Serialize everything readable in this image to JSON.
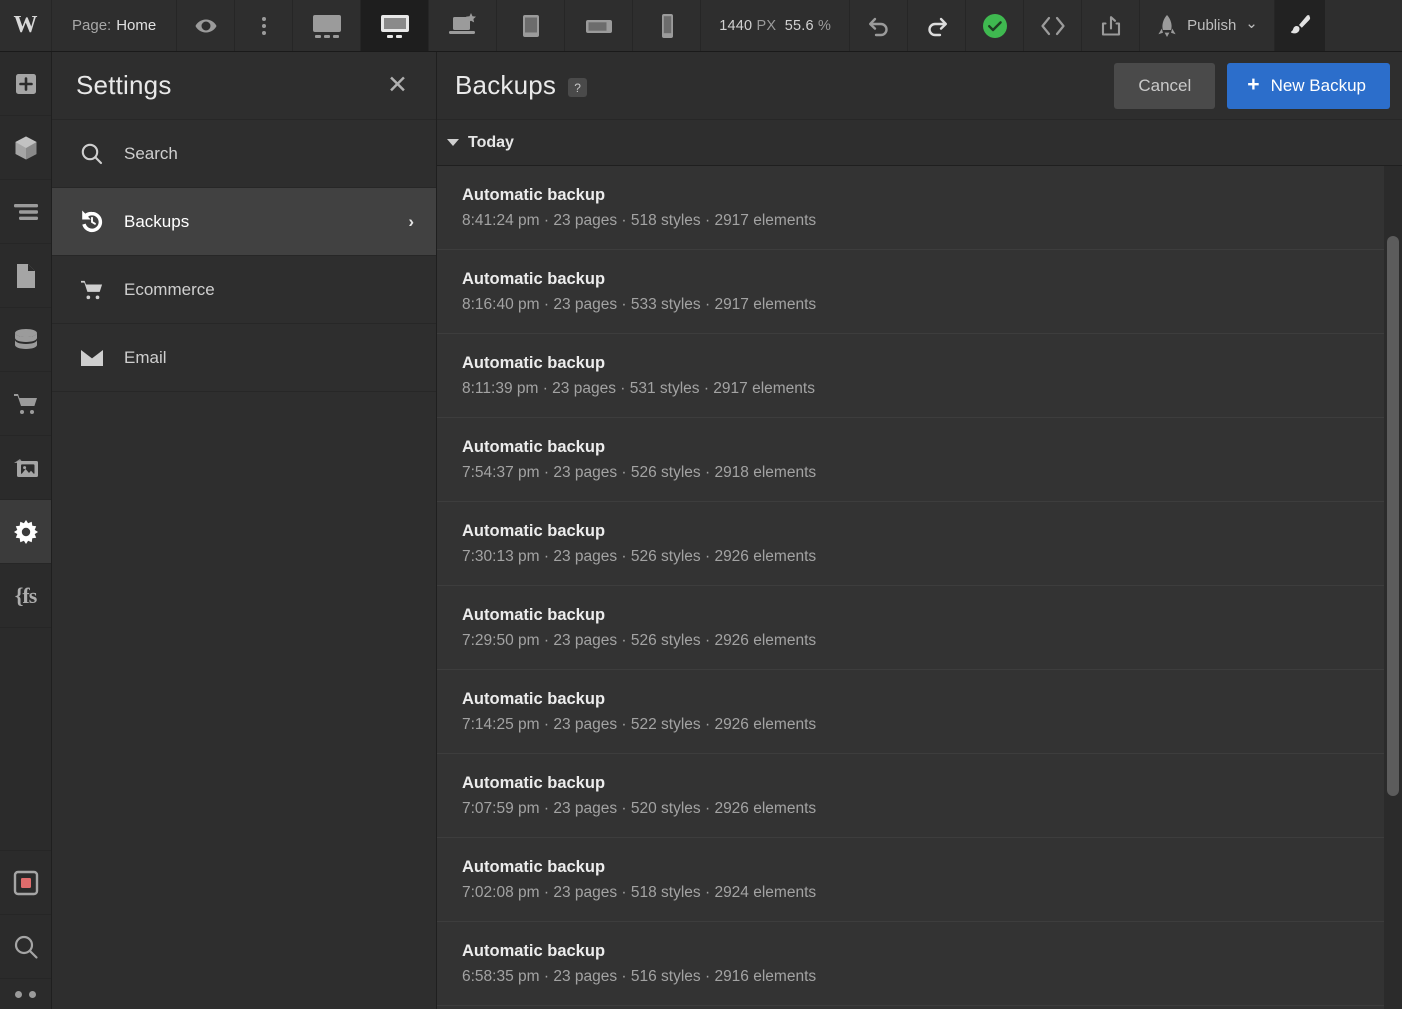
{
  "topbar": {
    "logo": "W",
    "page_label": "Page:",
    "page_name": "Home",
    "preview_icon": "eye-icon",
    "more_icon": "kebab-menu-icon",
    "devices": [
      {
        "name": "device-desktop-large",
        "label": "Desktop large"
      },
      {
        "name": "device-desktop",
        "label": "Desktop",
        "active": true
      },
      {
        "name": "device-desktop-starred",
        "label": "Desktop starred"
      },
      {
        "name": "device-tablet",
        "label": "Tablet"
      },
      {
        "name": "device-mobile-landscape",
        "label": "Mobile landscape"
      },
      {
        "name": "device-mobile-portrait",
        "label": "Mobile portrait"
      }
    ],
    "canvas_width": "1440",
    "canvas_width_unit": "PX",
    "zoom_value": "55.6",
    "zoom_unit": "%",
    "undo_icon": "undo-icon",
    "redo_icon": "redo-icon",
    "saved_icon": "checkmark-saved-icon",
    "code_icon": "code-brackets-icon",
    "export_icon": "export-share-icon",
    "publish_icon": "rocket-icon",
    "publish_label": "Publish",
    "publish_caret": "⌄",
    "brush_icon": "paintbrush-icon"
  },
  "rail": {
    "items": [
      {
        "name": "rail-add",
        "icon": "plus-square-icon"
      },
      {
        "name": "rail-symbols",
        "icon": "cube-icon"
      },
      {
        "name": "rail-navigator",
        "icon": "layers-lines-icon"
      },
      {
        "name": "rail-pages",
        "icon": "page-icon"
      },
      {
        "name": "rail-cms",
        "icon": "database-icon"
      },
      {
        "name": "rail-ecommerce",
        "icon": "shopping-cart-icon"
      },
      {
        "name": "rail-assets",
        "icon": "image-stack-icon"
      },
      {
        "name": "rail-settings",
        "icon": "gear-icon",
        "active": true
      },
      {
        "name": "rail-variables",
        "icon": "fs-braces-icon",
        "glyph": "{fs"
      }
    ],
    "bottom_items": [
      {
        "name": "rail-video",
        "icon": "video-square-icon"
      },
      {
        "name": "rail-search",
        "icon": "search-icon"
      },
      {
        "name": "rail-more",
        "icon": "dots-icon"
      }
    ]
  },
  "settings": {
    "title": "Settings",
    "close_icon": "close-icon",
    "items": [
      {
        "name": "settings-item-search",
        "label": "Search",
        "icon": "search-icon",
        "active": false,
        "chevron": false
      },
      {
        "name": "settings-item-backups",
        "label": "Backups",
        "icon": "history-clock-icon",
        "active": true,
        "chevron": true
      },
      {
        "name": "settings-item-ecommerce",
        "label": "Ecommerce",
        "icon": "shopping-cart-icon",
        "active": false,
        "chevron": false
      },
      {
        "name": "settings-item-email",
        "label": "Email",
        "icon": "envelope-icon",
        "active": false,
        "chevron": false
      }
    ],
    "chevron_glyph": "›"
  },
  "backups": {
    "title": "Backups",
    "help_label": "?",
    "cancel_label": "Cancel",
    "new_backup_label": "New Backup",
    "new_backup_plus": "+",
    "section_label": "Today",
    "rows": [
      {
        "title": "Automatic backup",
        "time": "8:41:24 pm",
        "pages": "23 pages",
        "styles": "518 styles",
        "elements": "2917 elements",
        "meta": "8:41:24 pm · 23 pages · 518 styles · 2917 elements"
      },
      {
        "title": "Automatic backup",
        "time": "8:16:40 pm",
        "pages": "23 pages",
        "styles": "533 styles",
        "elements": "2917 elements",
        "meta": "8:16:40 pm · 23 pages · 533 styles · 2917 elements"
      },
      {
        "title": "Automatic backup",
        "time": "8:11:39 pm",
        "pages": "23 pages",
        "styles": "531 styles",
        "elements": "2917 elements",
        "meta": "8:11:39 pm · 23 pages · 531 styles · 2917 elements"
      },
      {
        "title": "Automatic backup",
        "time": "7:54:37 pm",
        "pages": "23 pages",
        "styles": "526 styles",
        "elements": "2918 elements",
        "meta": "7:54:37 pm · 23 pages · 526 styles · 2918 elements"
      },
      {
        "title": "Automatic backup",
        "time": "7:30:13 pm",
        "pages": "23 pages",
        "styles": "526 styles",
        "elements": "2926 elements",
        "meta": "7:30:13 pm · 23 pages · 526 styles · 2926 elements"
      },
      {
        "title": "Automatic backup",
        "time": "7:29:50 pm",
        "pages": "23 pages",
        "styles": "526 styles",
        "elements": "2926 elements",
        "meta": "7:29:50 pm · 23 pages · 526 styles · 2926 elements"
      },
      {
        "title": "Automatic backup",
        "time": "7:14:25 pm",
        "pages": "23 pages",
        "styles": "522 styles",
        "elements": "2926 elements",
        "meta": "7:14:25 pm · 23 pages · 522 styles · 2926 elements"
      },
      {
        "title": "Automatic backup",
        "time": "7:07:59 pm",
        "pages": "23 pages",
        "styles": "520 styles",
        "elements": "2926 elements",
        "meta": "7:07:59 pm · 23 pages · 520 styles · 2926 elements"
      },
      {
        "title": "Automatic backup",
        "time": "7:02:08 pm",
        "pages": "23 pages",
        "styles": "518 styles",
        "elements": "2924 elements",
        "meta": "7:02:08 pm · 23 pages · 518 styles · 2924 elements"
      },
      {
        "title": "Automatic backup",
        "time": "6:58:35 pm",
        "pages": "23 pages",
        "styles": "516 styles",
        "elements": "2916 elements",
        "meta": "6:58:35 pm · 23 pages · 516 styles · 2916 elements"
      }
    ]
  },
  "colors": {
    "accent_blue": "#2c6ecb",
    "saved_green": "#3fb950",
    "panel_bg": "#2e2e2e",
    "list_bg": "#333333",
    "rail_bg": "#2b2b2b",
    "record_red": "#e06c6c"
  }
}
